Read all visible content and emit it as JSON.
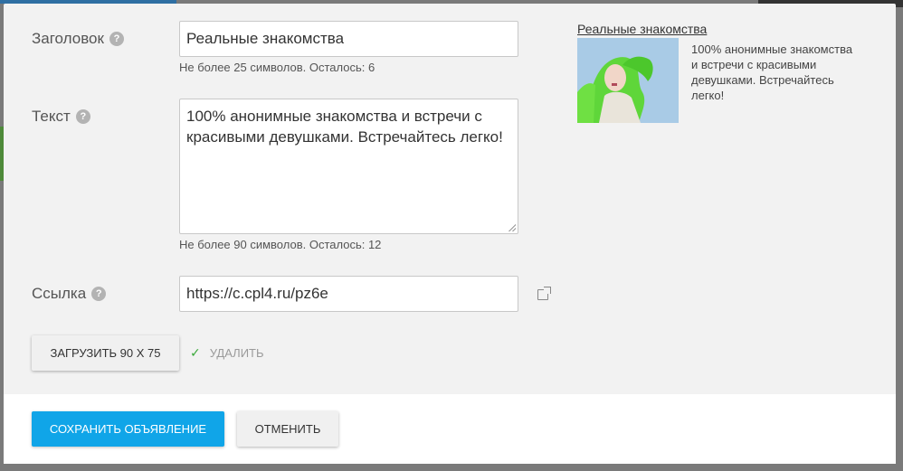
{
  "form": {
    "title": {
      "label": "Заголовок",
      "value": "Реальные знакомства",
      "hint": "Не более  25  символов. Осталось: 6"
    },
    "text": {
      "label": "Текст",
      "value": "100% анонимные знакомства и встречи с красивыми девушками. Встречайтесь легко!",
      "hint": "Не более  90  символов. Осталось: 12"
    },
    "link": {
      "label": "Ссылка",
      "value": "https://c.cpl4.ru/pz6e"
    },
    "upload_button": "ЗАГРУЗИТЬ 90 X 75",
    "delete_label": "УДАЛИТЬ"
  },
  "preview": {
    "title": "Реальные знакомства",
    "text": "100% анонимные знакомства и встречи с красивыми девушками. Встречайтесь легко!"
  },
  "footer": {
    "save_button": "СОХРАНИТЬ ОБЪЯВЛЕНИЕ",
    "cancel_button": "ОТМЕНИТЬ"
  },
  "help_glyph": "?",
  "colors": {
    "primary": "#10a5e8",
    "check": "#3aa93a"
  }
}
